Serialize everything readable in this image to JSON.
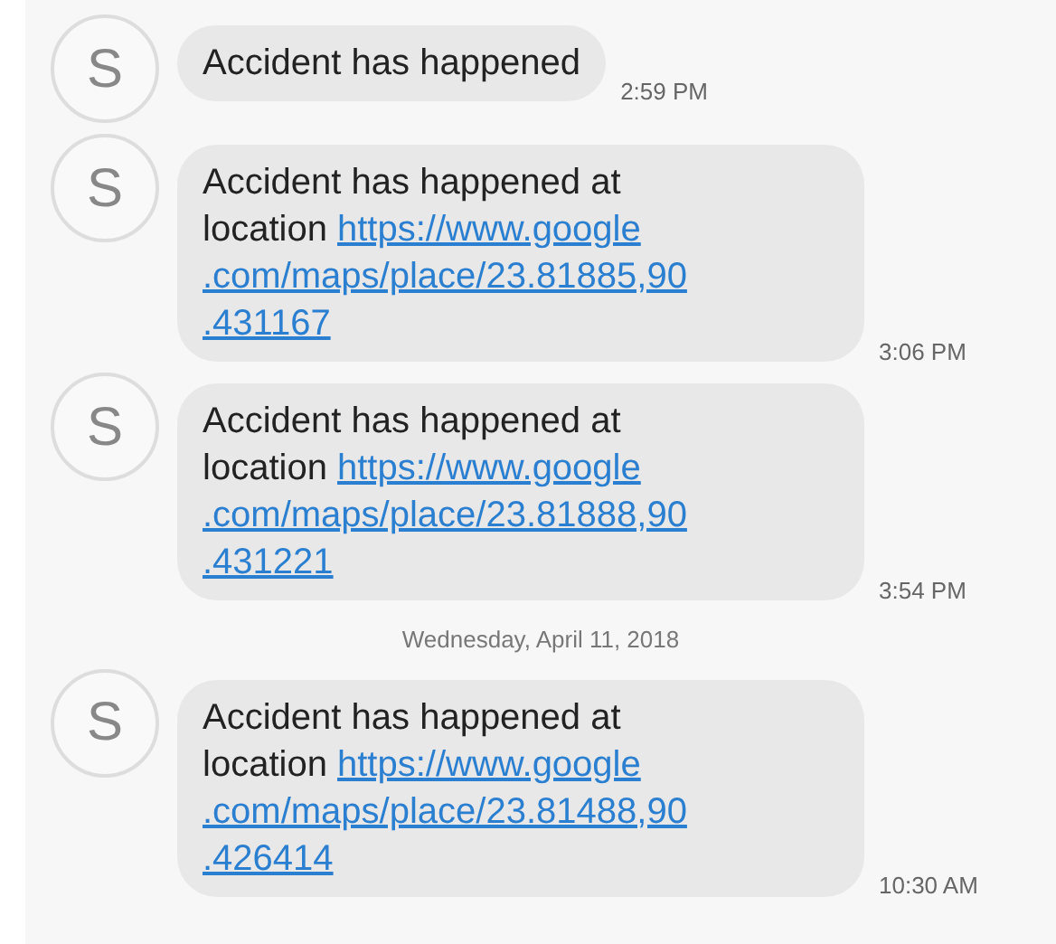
{
  "items": [
    {
      "kind": "message",
      "avatar": "S",
      "text_lines": [
        "Accident has happened"
      ],
      "time": "2:59 PM"
    },
    {
      "kind": "message",
      "avatar": "S",
      "text_lines": [
        "Accident has happened at",
        "location"
      ],
      "link_lines": [
        "https://www.google",
        ".com/maps/place/23.81885,90",
        ".431167"
      ],
      "time": "3:06 PM"
    },
    {
      "kind": "message",
      "avatar": "S",
      "text_lines": [
        "Accident has happened at",
        "location"
      ],
      "link_lines": [
        "https://www.google",
        ".com/maps/place/23.81888,90",
        ".431221"
      ],
      "time": "3:54 PM"
    },
    {
      "kind": "date",
      "text": "Wednesday, April 11, 2018"
    },
    {
      "kind": "message",
      "avatar": "S",
      "text_lines": [
        "Accident has happened at",
        "location"
      ],
      "link_lines": [
        "https://www.google",
        ".com/maps/place/23.81488,90",
        ".426414"
      ],
      "time": "10:30 AM"
    }
  ]
}
